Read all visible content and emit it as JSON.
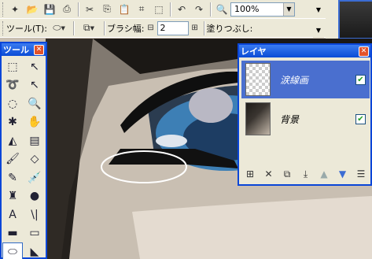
{
  "toolbar": {
    "zoom_value": "100%",
    "tool_label": "ツール(T):",
    "brush_label": "ブラシ幅:",
    "brush_width": "2",
    "fill_label": "塗りつぶし:"
  },
  "tool_window": {
    "title": "ツール",
    "close": "✕",
    "tools": [
      {
        "name": "rect-select-tool-icon",
        "glyph": "⬚"
      },
      {
        "name": "move-selection-tool-icon",
        "glyph": "↖"
      },
      {
        "name": "lasso-select-tool-icon",
        "glyph": "➰"
      },
      {
        "name": "move-pixels-tool-icon",
        "glyph": "↖"
      },
      {
        "name": "ellipse-select-tool-icon",
        "glyph": "◌"
      },
      {
        "name": "zoom-tool-icon",
        "glyph": "🔍"
      },
      {
        "name": "magic-wand-tool-icon",
        "glyph": "✱"
      },
      {
        "name": "pan-tool-icon",
        "glyph": "✋"
      },
      {
        "name": "paint-bucket-tool-icon",
        "glyph": "◭"
      },
      {
        "name": "gradient-tool-icon",
        "glyph": "▤"
      },
      {
        "name": "paintbrush-tool-icon",
        "glyph": "🖌"
      },
      {
        "name": "eraser-tool-icon",
        "glyph": "◇"
      },
      {
        "name": "pencil-tool-icon",
        "glyph": "✎"
      },
      {
        "name": "color-picker-tool-icon",
        "glyph": "💉"
      },
      {
        "name": "clone-stamp-tool-icon",
        "glyph": "♜"
      },
      {
        "name": "recolor-tool-icon",
        "glyph": "●"
      },
      {
        "name": "text-tool-icon",
        "glyph": "A"
      },
      {
        "name": "line-curve-tool-icon",
        "glyph": "\\|"
      },
      {
        "name": "rectangle-tool-icon",
        "glyph": "▬"
      },
      {
        "name": "rounded-rectangle-tool-icon",
        "glyph": "▭"
      },
      {
        "name": "ellipse-tool-icon",
        "glyph": "⬭"
      },
      {
        "name": "freeform-shape-tool-icon",
        "glyph": "◣"
      }
    ]
  },
  "layer_window": {
    "title": "レイヤ",
    "close": "✕",
    "layers": [
      {
        "name": "涙線画",
        "visible": "✔",
        "selected": true
      },
      {
        "name": "背景",
        "visible": "✔",
        "selected": false
      }
    ]
  },
  "colors": {
    "title_bar": "#0a4bd6",
    "selected_layer": "#4a6fcf",
    "canvas_skin": "#c9bfb2",
    "eye_blue": "#3d7fb5"
  }
}
